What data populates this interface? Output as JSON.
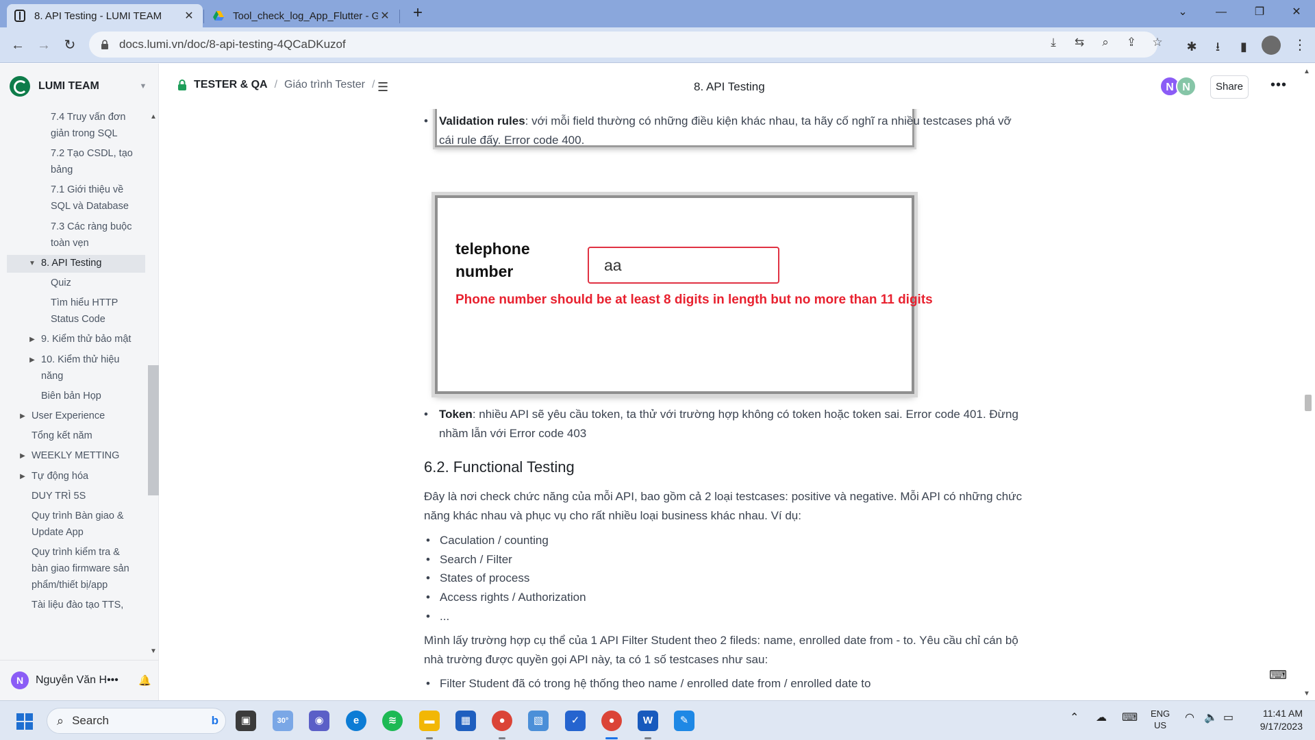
{
  "browser": {
    "tabs": [
      {
        "title": "8. API Testing - LUMI TEAM",
        "active": true
      },
      {
        "title": "Tool_check_log_App_Flutter - Go",
        "active": false
      }
    ],
    "url": "docs.lumi.vn/doc/8-api-testing-4QCaDKuzof"
  },
  "workspace": {
    "name": "LUMI TEAM"
  },
  "sidebar": {
    "items": [
      {
        "label": "7.4 Truy vấn đơn giản trong SQL",
        "level": 2,
        "caret": false
      },
      {
        "label": "7.2 Tạo CSDL, tạo bảng",
        "level": 2,
        "caret": false
      },
      {
        "label": "7.1 Giới thiệu về SQL và Database",
        "level": 2,
        "caret": false
      },
      {
        "label": "7.3 Các ràng buộc toàn vẹn",
        "level": 2,
        "caret": false
      },
      {
        "label": "8. API Testing",
        "level": 1,
        "caret": "down",
        "active": true
      },
      {
        "label": "Quiz",
        "level": 2,
        "caret": false
      },
      {
        "label": "Tìm hiểu HTTP Status Code",
        "level": 2,
        "caret": false
      },
      {
        "label": "9. Kiểm thử bảo mật",
        "level": 1,
        "caret": "right"
      },
      {
        "label": "10. Kiểm thử hiệu năng",
        "level": 1,
        "caret": "right"
      },
      {
        "label": "Biên bản Họp",
        "level": 1,
        "caret": false
      },
      {
        "label": "User Experience",
        "level": 0,
        "caret": "right"
      },
      {
        "label": "Tổng kết năm",
        "level": 0,
        "caret": false
      },
      {
        "label": "WEEKLY METTING",
        "level": 0,
        "caret": "right"
      },
      {
        "label": "Tự động hóa",
        "level": 0,
        "caret": "right"
      },
      {
        "label": "DUY TRÌ 5S",
        "level": 0,
        "caret": false
      },
      {
        "label": "Quy trình Bàn giao & Update App",
        "level": 0,
        "caret": false
      },
      {
        "label": "Quy trình kiểm tra & bàn giao firmware sản phẩm/thiết bị/app",
        "level": 0,
        "caret": false
      },
      {
        "label": "Tài liệu đào tạo TTS,",
        "level": 0,
        "caret": false
      }
    ],
    "user": {
      "initial": "N",
      "name": "Nguyễn Văn H•••",
      "avatar_color": "#8b5cf6"
    }
  },
  "header": {
    "breadcrumb": [
      "TESTER & QA",
      "Giáo trình Tester"
    ],
    "doc_title": "8. API Testing",
    "avatars": [
      {
        "initial": "N",
        "color": "#8b5cf6"
      },
      {
        "initial": "N",
        "color": "#86c5a7"
      }
    ],
    "share_label": "Share"
  },
  "content": {
    "validation": {
      "term": "Validation rules",
      "text": ": với mỗi field thường có những điều kiện khác nhau, ta hãy cố nghĩ ra nhiều testcases phá vỡ cái rule đấy. Error code 400."
    },
    "figure": {
      "label": "telephone number",
      "input_value": "aa",
      "error": "Phone number should be at least 8 digits in length but no more than 11 digits"
    },
    "token": {
      "term": "Token",
      "text": ": nhiều API sẽ yêu cầu token, ta thử với trường hợp không có token hoặc token sai. Error code 401. Đừng nhầm lẫn với Error code 403"
    },
    "heading": "6.2. Functional Testing",
    "para1": "Đây là nơi check chức năng của mỗi API, bao gồm cả 2 loại testcases: positive và negative. Mỗi API có những chức năng khác nhau và phục vụ cho rất nhiều loại business khác nhau. Ví dụ:",
    "list": [
      "Caculation / counting",
      "Search / Filter",
      "States of process",
      "Access rights / Authorization",
      "..."
    ],
    "para2": "Mình lấy trường hợp cụ thể của 1 API Filter Student theo 2 fileds: name, enrolled date from - to. Yêu cầu chỉ cán bộ nhà trường được quyền gọi API này, ta có 1 số testcases như sau:",
    "list2": [
      "Filter Student đã có trong hệ thống theo name / enrolled date from / enrolled date to"
    ]
  },
  "taskbar": {
    "search_label": "Search",
    "weather_temp": "30°",
    "lang_line1": "ENG",
    "lang_line2": "US",
    "time": "11:41 AM",
    "date": "9/17/2023"
  }
}
